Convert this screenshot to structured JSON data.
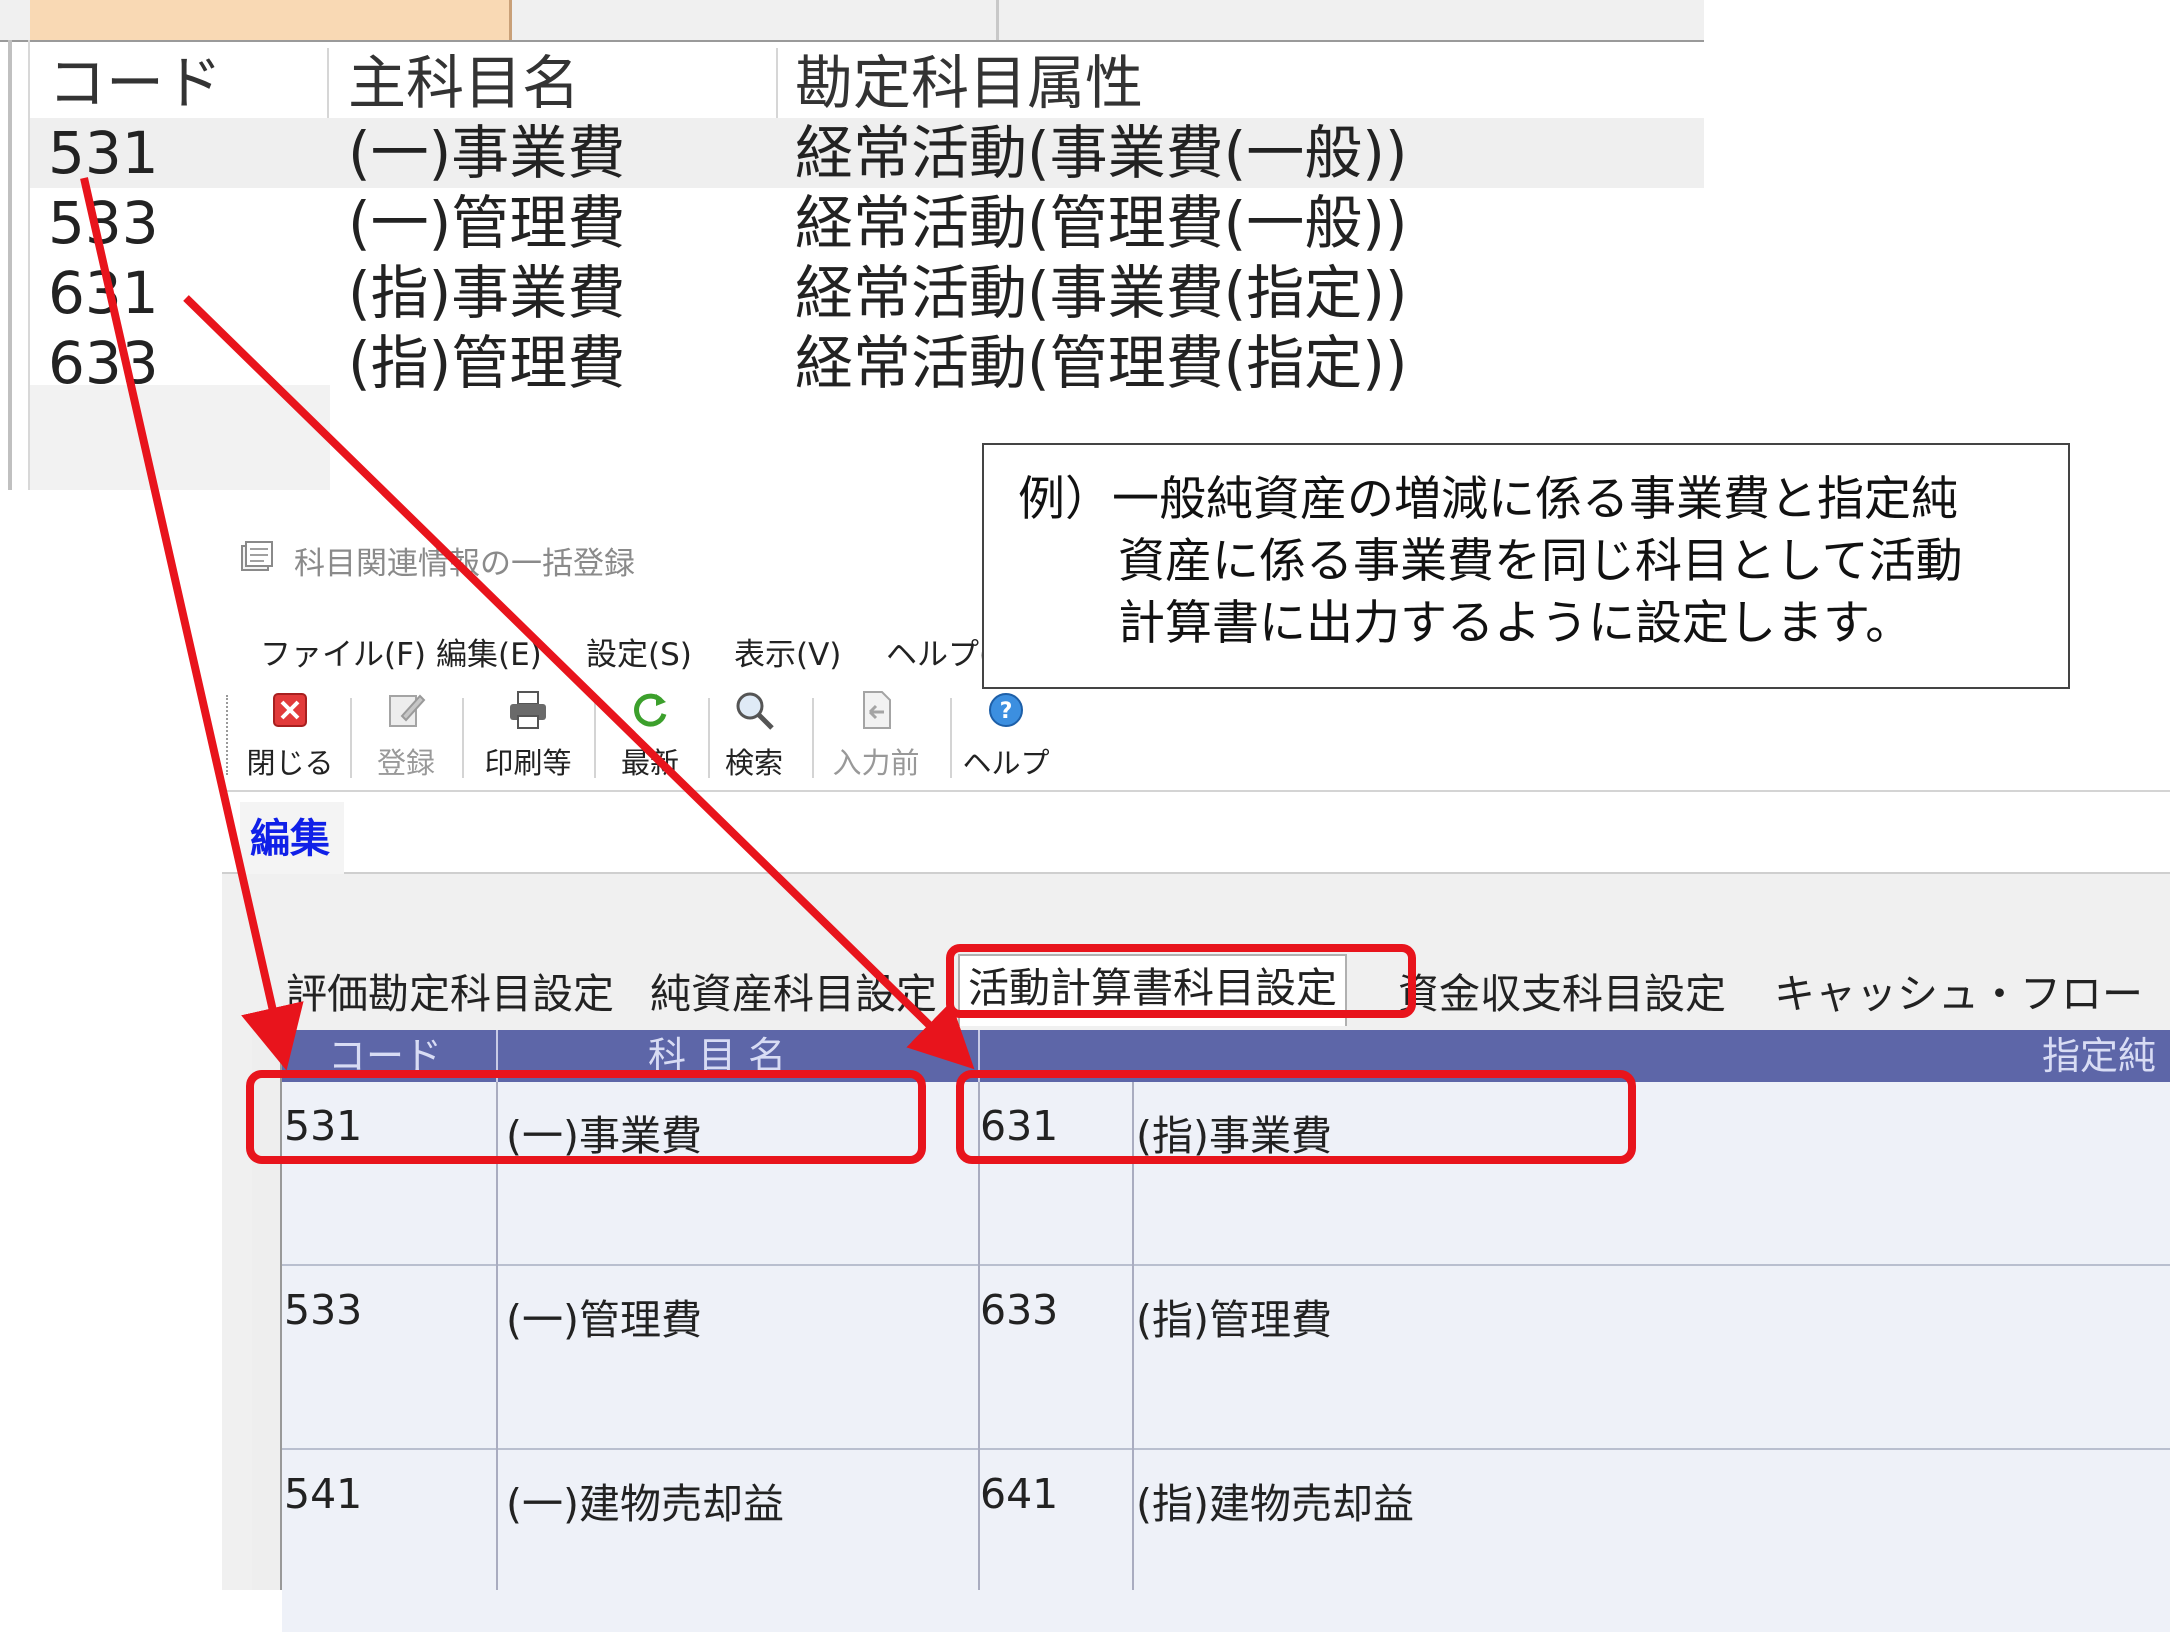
{
  "top_table": {
    "headers": [
      "コード",
      "主科目名",
      "勘定科目属性"
    ],
    "rows": [
      {
        "code": "531",
        "name": "(一)事業費",
        "attribute": "経常活動(事業費(一般))"
      },
      {
        "code": "533",
        "name": "(一)管理費",
        "attribute": "経常活動(管理費(一般))"
      },
      {
        "code": "631",
        "name": "(指)事業費",
        "attribute": "経常活動(事業費(指定))"
      },
      {
        "code": "633",
        "name": "(指)管理費",
        "attribute": "経常活動(管理費(指定))"
      }
    ]
  },
  "window": {
    "title": "科目関連情報の一括登録"
  },
  "menu": [
    "ファイル(F)",
    "編集(E)",
    "設定(S)",
    "表示(V)",
    "ヘルプ(H)"
  ],
  "toolbar": {
    "close": "閉じる",
    "register": "登録",
    "print": "印刷等",
    "refresh": "最新",
    "search": "検索",
    "before_input": "入力前",
    "help": "ヘルプ"
  },
  "edit_label": "編集",
  "tabs": [
    "評価勘定科目設定",
    "純資産科目設定",
    "活動計算書科目設定",
    "資金収支科目設定",
    "キャッシュ・フロー"
  ],
  "active_tab_index": 2,
  "grid": {
    "headers": {
      "code": "コード",
      "name": "科 目 名",
      "designated": "指定純"
    },
    "rows": [
      {
        "code": "531",
        "name": "(一)事業費",
        "code2": "631",
        "name2": "(指)事業費"
      },
      {
        "code": "533",
        "name": "(一)管理費",
        "code2": "633",
        "name2": "(指)管理費"
      },
      {
        "code": "541",
        "name": "(一)建物売却益",
        "code2": "641",
        "name2": "(指)建物売却益"
      }
    ]
  },
  "callout": {
    "line1": "例）一般純資産の増減に係る事業費と指定純",
    "line2": "資産に係る事業費を同じ科目として活動",
    "line3": "計算書に出力するように設定します。"
  },
  "colors": {
    "highlight_red": "#e8141c",
    "grid_header": "#5d66a8",
    "edit_label": "#1020e8"
  }
}
